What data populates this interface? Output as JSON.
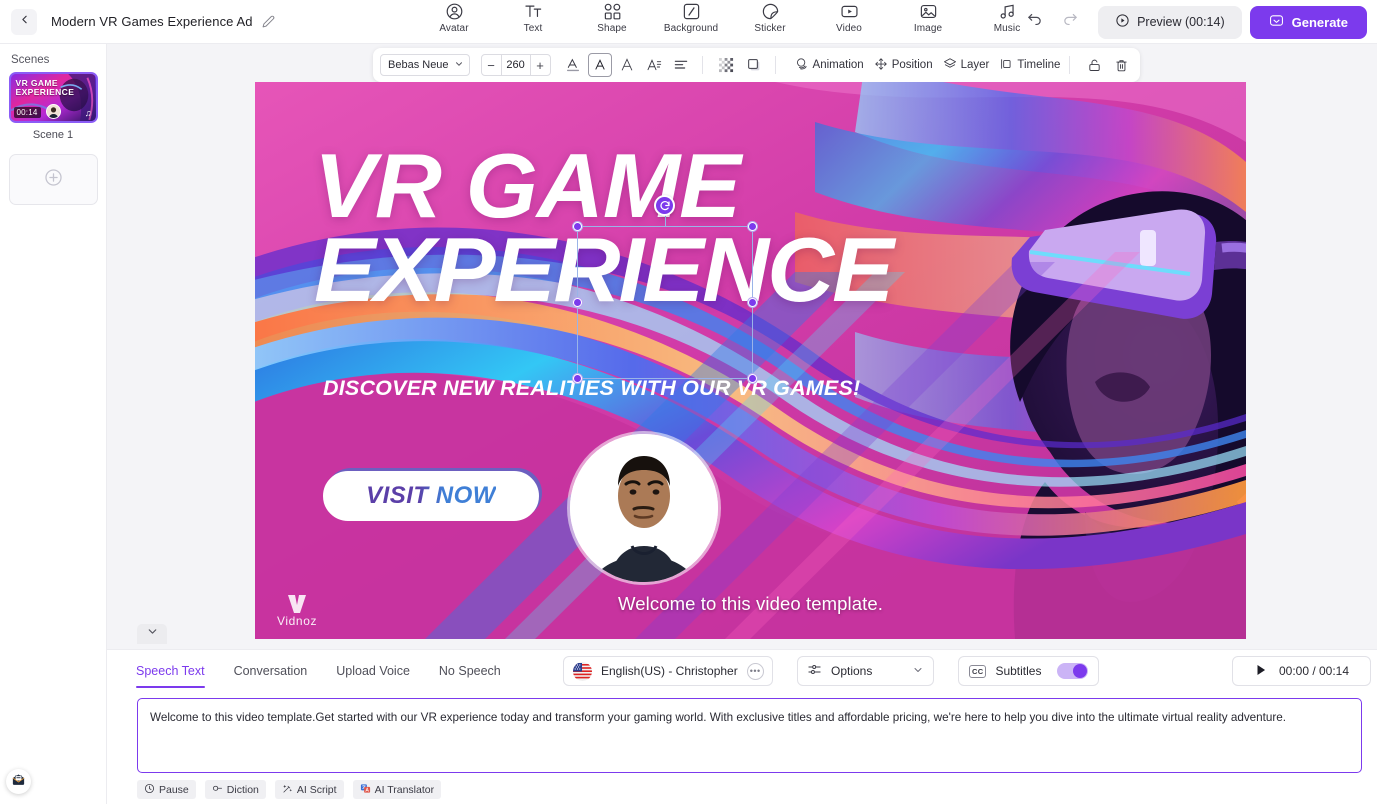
{
  "header": {
    "back_icon": "chevron-left-icon",
    "project_title": "Modern VR Games Experience Ad",
    "edit_icon": "pencil-icon",
    "tools": [
      {
        "icon": "avatar-icon",
        "label": "Avatar"
      },
      {
        "icon": "text-icon",
        "label": "Text"
      },
      {
        "icon": "shape-icon",
        "label": "Shape"
      },
      {
        "icon": "background-icon",
        "label": "Background"
      },
      {
        "icon": "sticker-icon",
        "label": "Sticker"
      },
      {
        "icon": "video-icon",
        "label": "Video"
      },
      {
        "icon": "image-icon",
        "label": "Image"
      },
      {
        "icon": "music-icon",
        "label": "Music"
      }
    ],
    "undo_icon": "undo-icon",
    "redo_icon": "redo-icon",
    "preview_label": "Preview (00:14)",
    "preview_icon": "play-circle-icon",
    "generate_label": "Generate",
    "generate_icon": "generate-icon",
    "accent_color": "#7c3aed"
  },
  "sidebar": {
    "title": "Scenes",
    "scene": {
      "thumb_title_line1": "VR GAME",
      "thumb_title_line2": "EXPERIENCE",
      "duration": "00:14",
      "music_icon": "music-note-icon",
      "name": "Scene 1"
    },
    "add_scene_icon": "plus-circle-icon",
    "help_icon": "mail-icon"
  },
  "edit_toolbar": {
    "font_family": "Bebas Neue",
    "font_dropdown_icon": "chevron-down-icon",
    "decrease_icon": "minus-icon",
    "font_size": "260",
    "increase_icon": "plus-icon",
    "text_color_icon": "text-color-icon",
    "fill_icon": "text-fill-icon",
    "outline_icon": "text-outline-icon",
    "effects_icon": "text-effects-icon",
    "align_icon": "align-left-icon",
    "opacity_icon": "transparency-icon",
    "shadow_icon": "shadow-icon",
    "animation_label": "Animation",
    "animation_icon": "animation-icon",
    "position_label": "Position",
    "position_icon": "position-move-icon",
    "layer_label": "Layer",
    "layer_icon": "layers-icon",
    "timeline_label": "Timeline",
    "timeline_icon": "timeline-icon",
    "lock_icon": "lock-icon",
    "delete_icon": "trash-icon"
  },
  "canvas": {
    "title_line1": "VR GAME",
    "title_line2": "EXPERIENCE",
    "subtitle": "DISCOVER NEW REALITIES WITH OUR VR GAMES!",
    "cta_label": "VISIT NOW",
    "brand_name": "Vidnoz",
    "caption": "Welcome to this video template.",
    "rotate_icon": "rotate-icon",
    "collapse_icon": "chevron-down-icon"
  },
  "bottom": {
    "tabs": [
      {
        "label": "Speech Text",
        "active": true
      },
      {
        "label": "Conversation",
        "active": false
      },
      {
        "label": "Upload Voice",
        "active": false
      },
      {
        "label": "No Speech",
        "active": false
      }
    ],
    "voice": {
      "flag_icon": "us-flag-icon",
      "name": "English(US) - Christopher",
      "more_icon": "ellipsis-icon"
    },
    "options": {
      "icon": "sliders-icon",
      "label": "Options",
      "chevron_icon": "chevron-down-icon"
    },
    "subtitles": {
      "icon": "cc-icon",
      "label": "Subtitles",
      "enabled": true
    },
    "player": {
      "play_icon": "play-icon",
      "time": "00:00 / 00:14"
    },
    "script_text": "Welcome to this video template.Get started with our VR experience today and transform your gaming world. With exclusive titles and affordable pricing, we're here to help you dive into the ultimate virtual reality adventure.",
    "chips": [
      {
        "icon": "clock-icon",
        "label": "Pause"
      },
      {
        "icon": "diction-icon",
        "label": "Diction"
      },
      {
        "icon": "sparkle-icon",
        "label": "AI Script"
      },
      {
        "icon": "translate-icon",
        "label": "AI Translator"
      }
    ]
  }
}
